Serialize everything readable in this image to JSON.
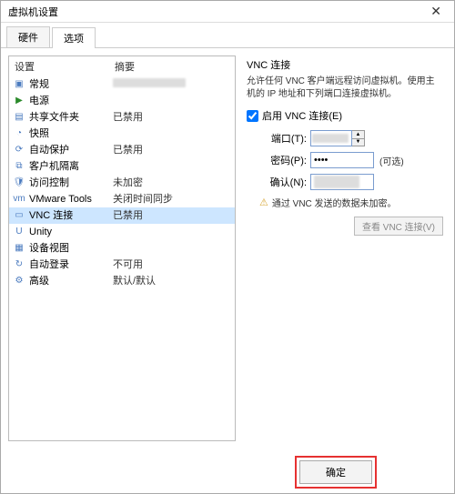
{
  "window": {
    "title": "虚拟机设置"
  },
  "tabs": {
    "hardware": "硬件",
    "options": "选项"
  },
  "list": {
    "header": {
      "setting": "设置",
      "summary": "摘要"
    },
    "items": [
      {
        "icon": "▣",
        "label": "常规",
        "summary_blur": true
      },
      {
        "icon": "▶",
        "icon_class": "green",
        "label": "电源",
        "summary": ""
      },
      {
        "icon": "▤",
        "label": "共享文件夹",
        "summary": "已禁用"
      },
      {
        "icon": "◔",
        "label": "快照",
        "summary": ""
      },
      {
        "icon": "⟳",
        "label": "自动保护",
        "summary": "已禁用"
      },
      {
        "icon": "⧉",
        "label": "客户机隔离",
        "summary": ""
      },
      {
        "icon": "🛡",
        "label": "访问控制",
        "summary": "未加密"
      },
      {
        "icon": "vm",
        "label": "VMware Tools",
        "summary": "关闭时间同步"
      },
      {
        "icon": "▭",
        "label": "VNC 连接",
        "summary": "已禁用",
        "selected": true
      },
      {
        "icon": "U",
        "label": "Unity",
        "summary": ""
      },
      {
        "icon": "▦",
        "label": "设备视图",
        "summary": ""
      },
      {
        "icon": "↻",
        "label": "自动登录",
        "summary": "不可用"
      },
      {
        "icon": "⚙",
        "label": "高级",
        "summary": "默认/默认"
      }
    ]
  },
  "vnc": {
    "title": "VNC 连接",
    "desc": "允许任何 VNC 客户端远程访问虚拟机。使用主机的 IP 地址和下列端口连接虚拟机。",
    "enable_label": "启用 VNC 连接(E)",
    "port_label": "端口(T):",
    "port_value": "",
    "password_label": "密码(P):",
    "password_optional": "(可选)",
    "confirm_label": "确认(N):",
    "warning": "通过 VNC 发送的数据未加密。",
    "view_btn": "查看 VNC 连接(V)"
  },
  "buttons": {
    "ok": "确定"
  }
}
